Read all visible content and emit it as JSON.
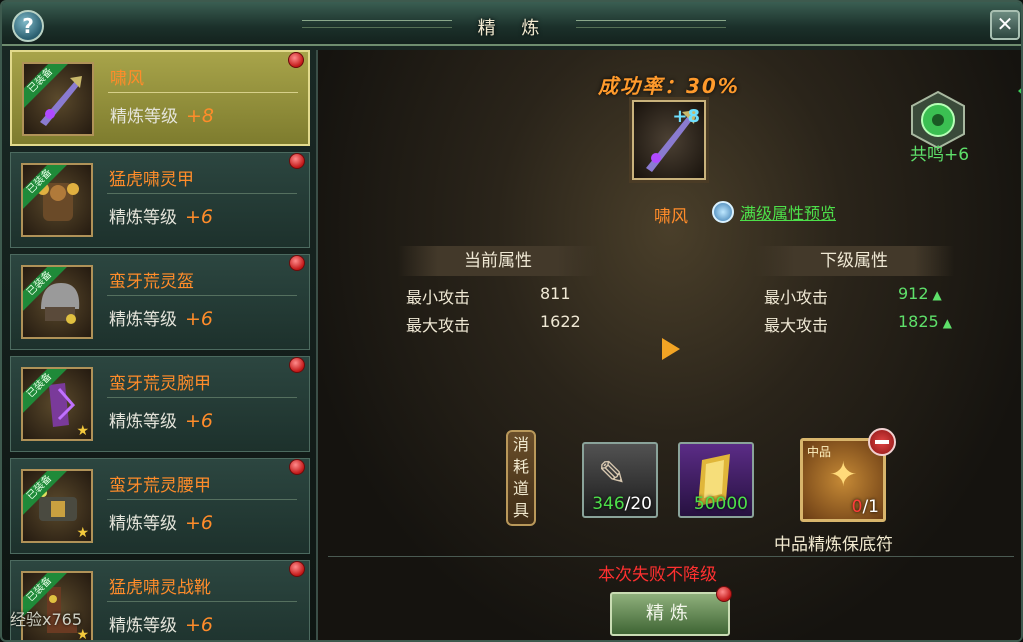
{
  "window": {
    "title": "精 炼",
    "help_icon": "help-icon",
    "close_icon": "close-icon"
  },
  "equipment_list": [
    {
      "badge": "已装备",
      "name": "啸风",
      "level_label": "精炼等级",
      "level_plus": "+8",
      "selected": true,
      "star": false
    },
    {
      "badge": "已装备",
      "name": "猛虎啸灵甲",
      "level_label": "精炼等级",
      "level_plus": "+6",
      "selected": false,
      "star": false
    },
    {
      "badge": "已装备",
      "name": "蛮牙荒灵盔",
      "level_label": "精炼等级",
      "level_plus": "+6",
      "selected": false,
      "star": false
    },
    {
      "badge": "已装备",
      "name": "蛮牙荒灵腕甲",
      "level_label": "精炼等级",
      "level_plus": "+6",
      "selected": false,
      "star": true
    },
    {
      "badge": "已装备",
      "name": "蛮牙荒灵腰甲",
      "level_label": "精炼等级",
      "level_plus": "+6",
      "selected": false,
      "star": true
    },
    {
      "badge": "已装备",
      "name": "猛虎啸灵战靴",
      "level_label": "精炼等级",
      "level_plus": "+6",
      "selected": false,
      "star": true
    }
  ],
  "overlay_text": "经验x765",
  "refine": {
    "success_rate": "成功率：30%",
    "equip_plus": "+8",
    "equip_name": "啸风",
    "preview_link": "满级属性预览",
    "resonance_label": "共鸣+6",
    "current_header": "当前属性",
    "next_header": "下级属性",
    "current_stats": [
      {
        "label": "最小攻击",
        "value": "811"
      },
      {
        "label": "最大攻击",
        "value": "1622"
      }
    ],
    "next_stats": [
      {
        "label": "最小攻击",
        "value": "912"
      },
      {
        "label": "最大攻击",
        "value": "1825"
      }
    ],
    "consume_label": "消耗道具",
    "materials": [
      {
        "have": "346",
        "need": "/20"
      },
      {
        "amount": "50000"
      },
      {
        "grade": "中品",
        "have": "0",
        "need": "/1",
        "name": "中品精炼保底符"
      }
    ],
    "warning": "本次失败不降级",
    "button_label": "精炼"
  },
  "colors": {
    "item_name": "#ff8c2a",
    "green": "#4de04a",
    "warn": "#ff3030",
    "selected_bg": "#a8a44a"
  }
}
